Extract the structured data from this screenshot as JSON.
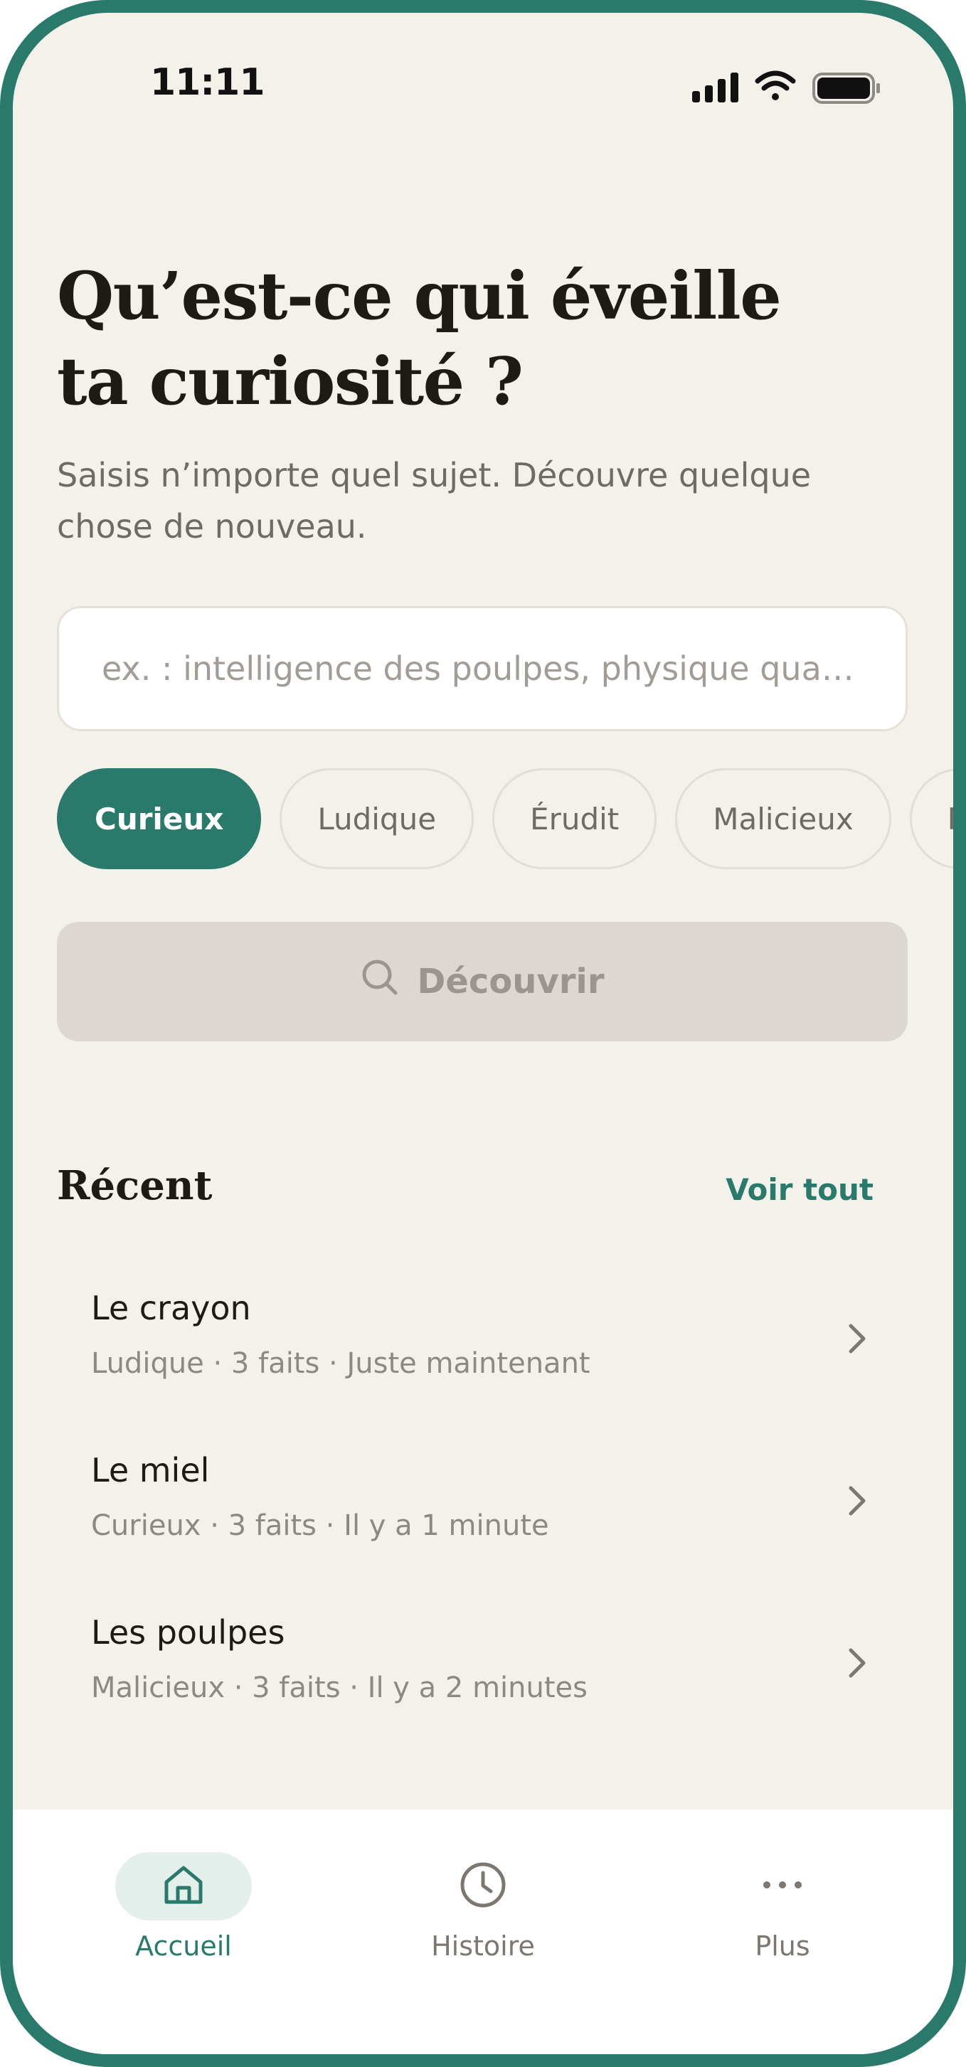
{
  "status_bar": {
    "time": "11:11",
    "icons": [
      "cellular-signal-icon",
      "wifi-icon",
      "battery-icon"
    ]
  },
  "header": {
    "title_line1": "Qu’est-ce qui éveille",
    "title_line2": "ta curiosité ?",
    "subtitle_line1": "Saisis n’importe quel sujet. Découvre quelque",
    "subtitle_line2": "chose de nouveau."
  },
  "search": {
    "value": "",
    "placeholder": "ex. : intelligence des poulpes, physique qua…"
  },
  "tones": [
    {
      "label": "Curieux",
      "selected": true
    },
    {
      "label": "Ludique",
      "selected": false
    },
    {
      "label": "Érudit",
      "selected": false
    },
    {
      "label": "Malicieux",
      "selected": false
    },
    {
      "label": "Poé",
      "selected": false
    }
  ],
  "discover_button": {
    "label": "Découvrir",
    "icon": "search-icon",
    "enabled": false
  },
  "recent": {
    "title": "Récent",
    "see_all": "Voir tout",
    "items": [
      {
        "title": "Le crayon",
        "meta": "Ludique · 3 faits · Juste maintenant"
      },
      {
        "title": "Le miel",
        "meta": "Curieux · 3 faits · Il y a 1 minute"
      },
      {
        "title": "Les poulpes",
        "meta": "Malicieux · 3 faits · Il y a 2 minutes"
      }
    ]
  },
  "tab_bar": {
    "tabs": [
      {
        "label": "Accueil",
        "icon": "home-icon",
        "active": true
      },
      {
        "label": "Histoire",
        "icon": "clock-icon",
        "active": false
      },
      {
        "label": "Plus",
        "icon": "more-icon",
        "active": false
      }
    ]
  },
  "colors": {
    "accent": "#2a7a6c",
    "background": "#f4f1eb",
    "text_primary": "#1e1a16",
    "text_secondary": "#6f6a64",
    "button_disabled": "#dcd8d1"
  }
}
